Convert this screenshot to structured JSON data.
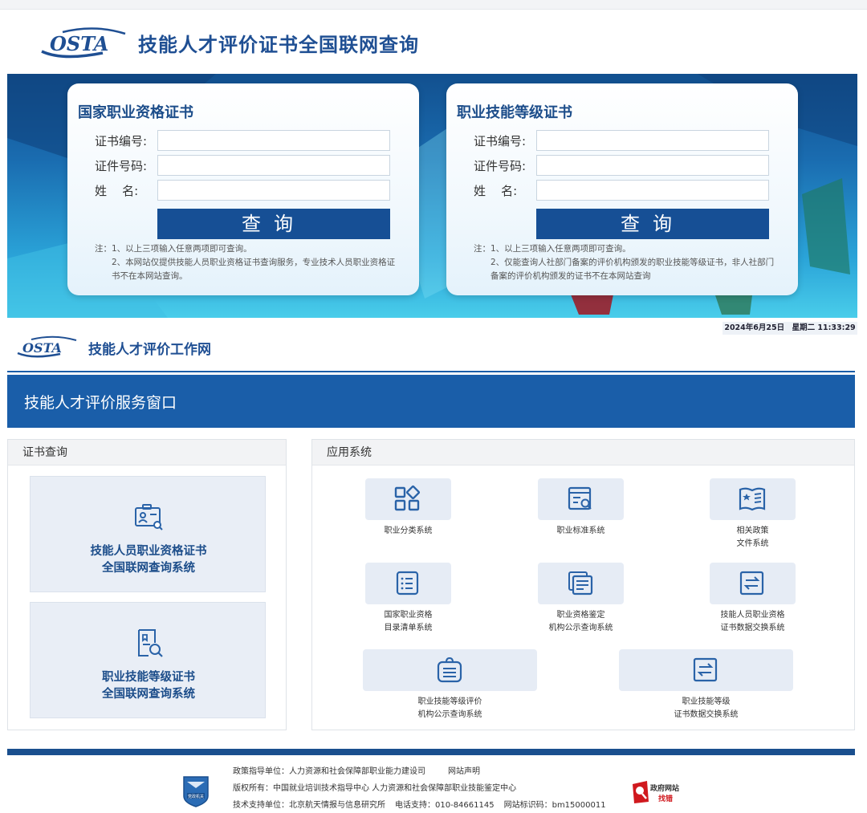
{
  "colors": {
    "brand": "#1f4f93",
    "accent_bar": "#1a5ea9",
    "button": "#164f95"
  },
  "header": {
    "logo_text": "OSTA",
    "title": "技能人才评价证书全国联网查询"
  },
  "hero": {
    "left_card": {
      "title": "国家职业资格证书",
      "fields": [
        {
          "label": "证书编号:",
          "value": ""
        },
        {
          "label": "证件号码:",
          "value": ""
        },
        {
          "label": "姓    名:",
          "value": ""
        }
      ],
      "button": "查询",
      "note_1": "注：1、以上三项输入任意两项即可查询。",
      "note_2": "2、本网站仅提供技能人员职业资格证书查询服务，专业技术人员职业资格证书不在本网站查询。"
    },
    "right_card": {
      "title": "职业技能等级证书",
      "fields": [
        {
          "label": "证书编号:",
          "value": ""
        },
        {
          "label": "证件号码:",
          "value": ""
        },
        {
          "label": "姓    名:",
          "value": ""
        }
      ],
      "button": "查询",
      "note_1": "注：1、以上三项输入任意两项即可查询。",
      "note_2": "2、仅能查询人社部门备案的评价机构颁发的职业技能等级证书，非人社部门备案的评价机构颁发的证书不在本网站查询"
    }
  },
  "datetime": "2024年6月25日　星期二 11:33:29",
  "subheader": {
    "logo_text": "OSTA",
    "title": "技能人才评价工作网"
  },
  "service_window": {
    "title": "技能人才评价服务窗口"
  },
  "cert_panel": {
    "title": "证书查询",
    "tiles": [
      {
        "line1": "技能人员职业资格证书",
        "line2": "全国联网查询系统",
        "icon": "id-card-search-icon"
      },
      {
        "line1": "职业技能等级证书",
        "line2": "全国联网查询系统",
        "icon": "certificate-search-icon"
      }
    ]
  },
  "app_panel": {
    "title": "应用系统",
    "apps": [
      {
        "line1": "职业分类系统",
        "line2": "",
        "icon": "grid-diamond-icon"
      },
      {
        "line1": "职业标准系统",
        "line2": "",
        "icon": "document-search-icon"
      },
      {
        "line1": "相关政策",
        "line2": "文件系统",
        "icon": "policy-book-icon"
      },
      {
        "line1": "国家职业资格",
        "line2": "目录清单系统",
        "icon": "list-icon"
      },
      {
        "line1": "职业资格鉴定",
        "line2": "机构公示查询系统",
        "icon": "stacked-docs-icon"
      },
      {
        "line1": "技能人员职业资格",
        "line2": "证书数据交换系统",
        "icon": "exchange-icon"
      },
      {
        "line1": "职业技能等级评价",
        "line2": "机构公示查询系统",
        "icon": "institution-icon"
      },
      {
        "line1": "职业技能等级",
        "line2": "证书数据交换系统",
        "icon": "exchange-icon"
      }
    ]
  },
  "footer": {
    "line1_a": "政策指导单位：人力资源和社会保障部职业能力建设司",
    "line1_b": "网站声明",
    "line2": "版权所有：中国就业培训技术指导中心  人力资源和社会保障部职业技能鉴定中心",
    "line3_a": "技术支持单位：北京航天情报与信息研究所",
    "line3_b": "电话支持：010-84661145",
    "line3_c": "网站标识码：bm15000011",
    "badge_left_text": "党政机关",
    "gov_top": "政府网站",
    "gov_bottom": "找错"
  }
}
